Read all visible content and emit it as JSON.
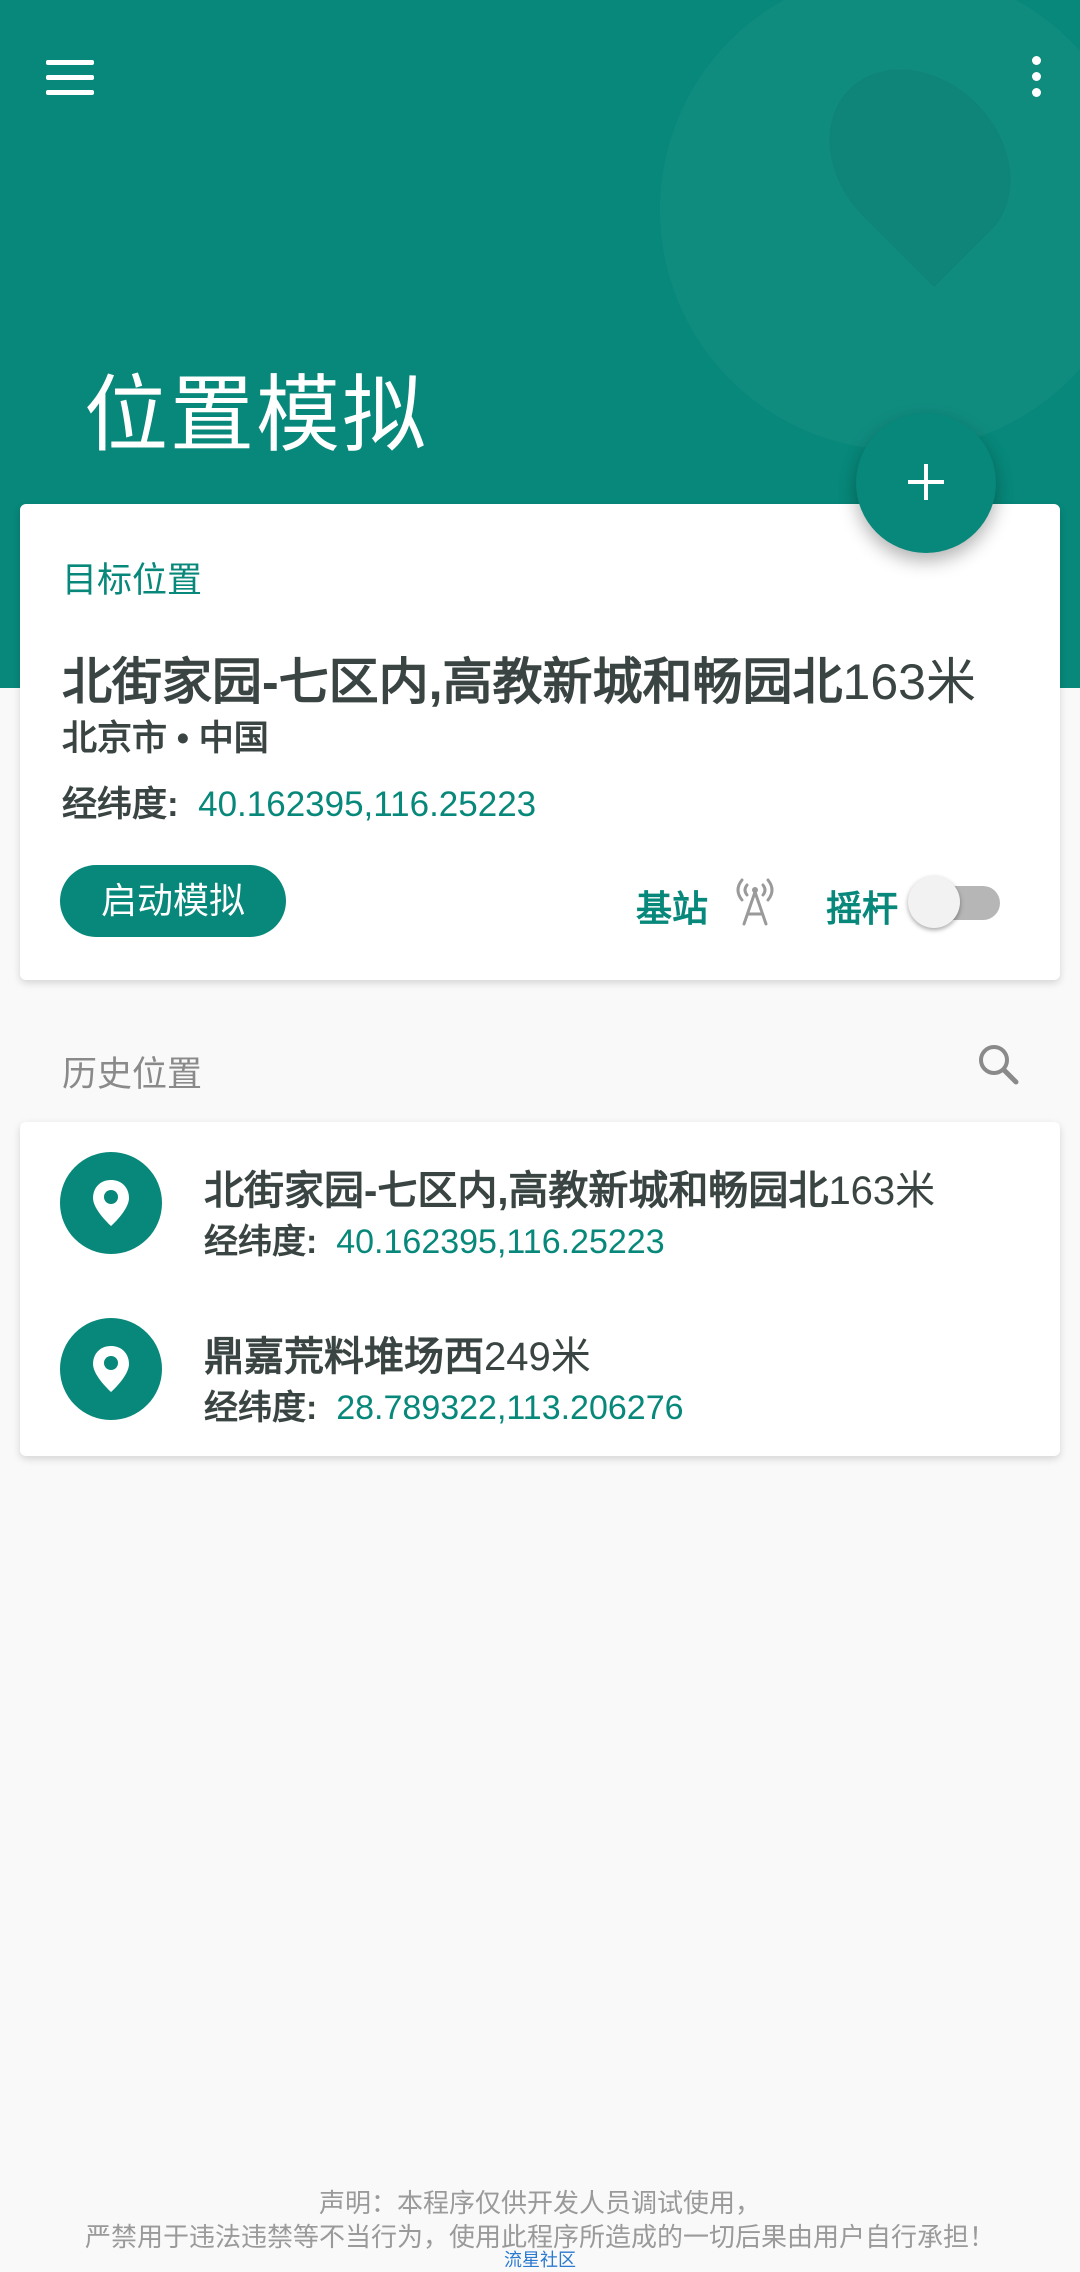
{
  "header": {
    "title": "位置模拟"
  },
  "target": {
    "section_label": "目标位置",
    "place_name": "北街家园-七区内,高教新城和畅园北",
    "distance": "163米",
    "region": "北京市 • 中国",
    "coord_label": "经纬度:",
    "coord_value": "40.162395,116.25223",
    "start_button": "启动模拟",
    "base_station_label": "基站",
    "joystick_label": "摇杆",
    "joystick_enabled": false
  },
  "history": {
    "section_label": "历史位置",
    "items": [
      {
        "name": "北街家园-七区内,高教新城和畅园北",
        "distance": "163米",
        "coord_label": "经纬度:",
        "coord_value": "40.162395,116.25223"
      },
      {
        "name": "鼎嘉荒料堆场西",
        "distance": "249米",
        "coord_label": "经纬度:",
        "coord_value": "28.789322,113.206276"
      }
    ]
  },
  "footer": {
    "line1": "声明：本程序仅供开发人员调试使用，",
    "line2": "严禁用于违法违禁等不当行为，使用此程序所造成的一切后果由用户自行承担！",
    "link": "流星社区"
  },
  "colors": {
    "primary": "#07887a",
    "text_dark": "#3a4543",
    "background": "#f9f9f9"
  },
  "icons": {
    "menu": "menu-icon",
    "more": "more-vert-icon",
    "fab": "plus-icon",
    "base_station": "antenna-icon",
    "search": "search-icon",
    "history_pin": "location-pin-icon"
  }
}
